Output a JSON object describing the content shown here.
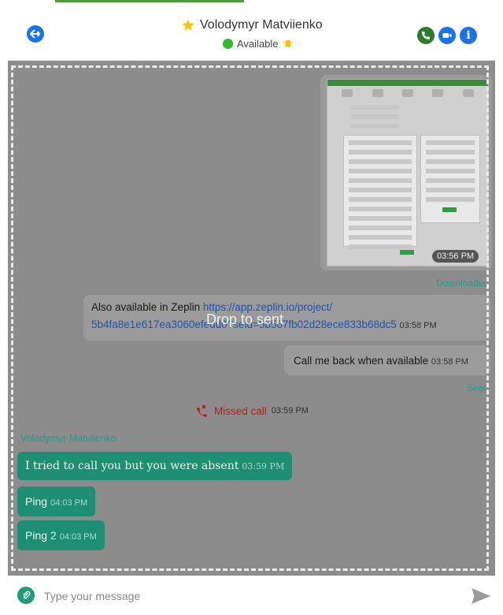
{
  "header": {
    "contact_name": "Volodymyr Matviienko",
    "status": "Available",
    "colors": {
      "status": "#2ebd2e",
      "call": "#2a7d2a",
      "accent": "#1a73e8"
    }
  },
  "chat": {
    "drop_text": "Drop to sent",
    "image_message": {
      "time": "03:56 PM",
      "state": "Downloaded"
    },
    "messages_out": [
      {
        "text": "Also available in Zeplin",
        "link_part1": "https://app.zeplin.io/project/",
        "link_part2": "5b4fa8e1e617ea3060efedd0?seid=5b567fb02d28ece833b68dc5",
        "time": "03:58 PM"
      },
      {
        "text": "Call me back when available",
        "time": "03:58 PM"
      }
    ],
    "seen_label": "Seen",
    "missed_call": {
      "label": "Missed call",
      "time": "03:59 PM",
      "color": "#b51f1f"
    },
    "sender_name": "Volodymyr Matviienko",
    "messages_in": [
      {
        "text": "I tried to call you but you were absent",
        "time": "03:59 PM"
      },
      {
        "text": "Ping",
        "time": "04:03 PM"
      },
      {
        "text": "Ping 2",
        "time": "04:03 PM"
      }
    ]
  },
  "composer": {
    "placeholder": "Type your message",
    "value": ""
  }
}
